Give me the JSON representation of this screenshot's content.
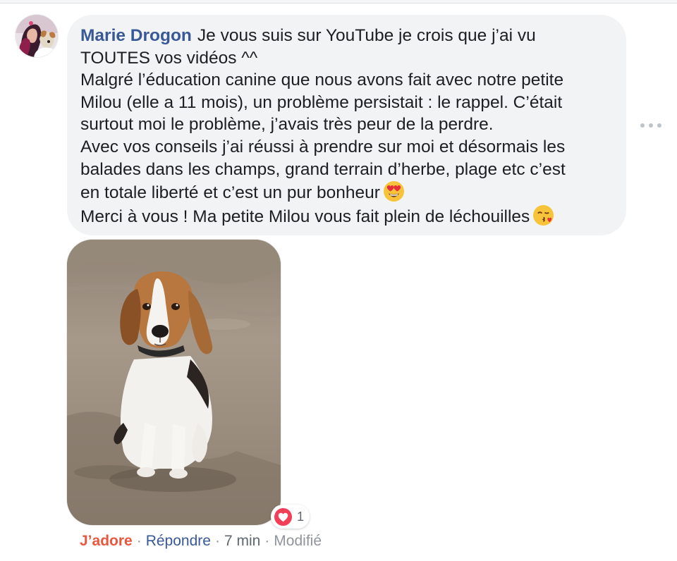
{
  "comment": {
    "author": "Marie Drogon",
    "lines": [
      "Je vous suis sur YouTube je crois que j’ai vu",
      "TOUTES vos vidéos ^^",
      "Malgré l’éducation canine que nous avons fait avec notre petite",
      "Milou (elle a 11 mois), un problème persistait : le rappel. C’était",
      "surtout moi le problème, j’avais très peur de la perdre.",
      "Avec vos conseils j’ai réussi à prendre sur moi et désormais les",
      "balades dans les champs, grand terrain d’herbe, plage etc c’est",
      "en totale liberté et c’est un pur bonheur",
      "Merci à vous ! Ma petite Milou vous fait plein de léchouilles"
    ],
    "emojis": {
      "line8": "heart-eyes-emoji",
      "line9": "kissing-heart-emoji"
    }
  },
  "reactions": {
    "icon": "heart-icon",
    "count": "1"
  },
  "actions": {
    "love": "J’adore",
    "separator": "·",
    "reply": "Répondre",
    "time": "7 min",
    "edited": "Modifié"
  },
  "colors": {
    "bubble": "#f2f3f5",
    "author": "#385898",
    "love": "#e9573e",
    "reply": "#385898",
    "muted": "#90949c",
    "heart": "#f33e58"
  }
}
